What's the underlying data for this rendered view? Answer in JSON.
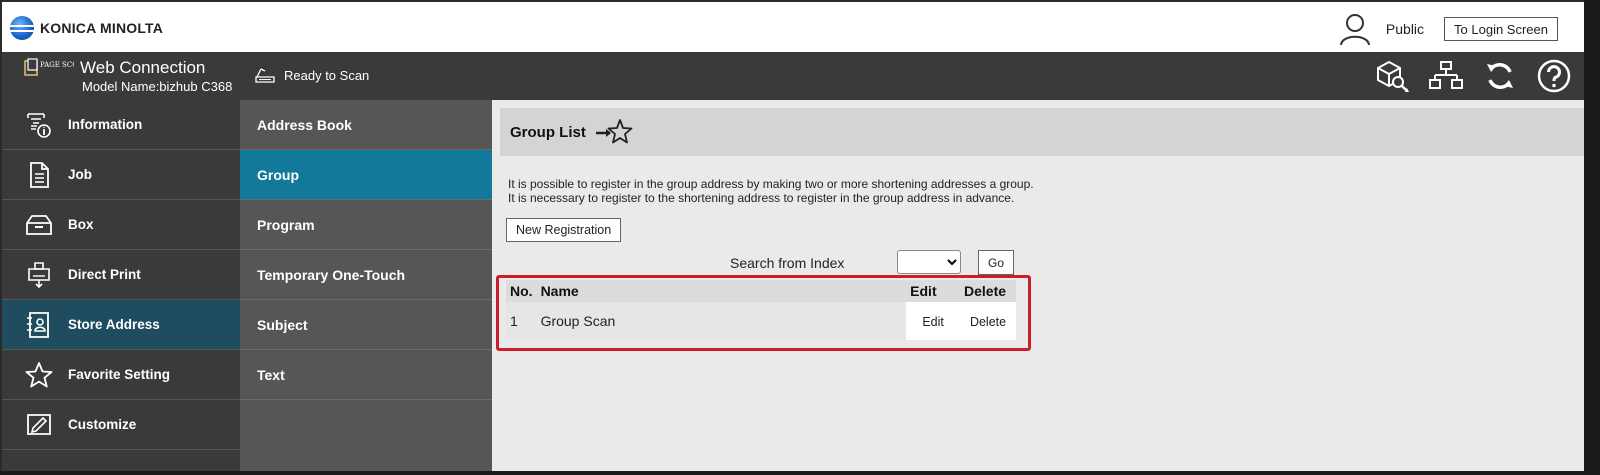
{
  "topbar": {
    "brand": "KONICA MINOLTA",
    "user_name": "Public",
    "login_button": "To Login Screen"
  },
  "header": {
    "pagescope_label": "PAGE SCOPE",
    "app_title": "Web Connection",
    "model_label": "Model Name:bizhub C368",
    "status": "Ready to Scan",
    "icons": [
      "search-box-icon",
      "network-icon",
      "refresh-icon",
      "help-icon"
    ]
  },
  "sidebar": {
    "items": [
      {
        "label": "Information",
        "icon": "information-icon",
        "active": false
      },
      {
        "label": "Job",
        "icon": "job-icon",
        "active": false
      },
      {
        "label": "Box",
        "icon": "box-icon",
        "active": false
      },
      {
        "label": "Direct Print",
        "icon": "direct-print-icon",
        "active": false
      },
      {
        "label": "Store Address",
        "icon": "store-address-icon",
        "active": true
      },
      {
        "label": "Favorite Setting",
        "icon": "star-icon",
        "active": false
      },
      {
        "label": "Customize",
        "icon": "customize-icon",
        "active": false
      }
    ]
  },
  "submenu": {
    "items": [
      {
        "label": "Address Book",
        "active": false
      },
      {
        "label": "Group",
        "active": true
      },
      {
        "label": "Program",
        "active": false
      },
      {
        "label": "Temporary One-Touch",
        "active": false
      },
      {
        "label": "Subject",
        "active": false
      },
      {
        "label": "Text",
        "active": false
      }
    ]
  },
  "main": {
    "title": "Group List",
    "desc_line1": "It is possible to register in the group address by making two or more shortening addresses a group.",
    "desc_line2": "It is necessary to register to the shortening address to register in the group address in advance.",
    "new_registration": "New Registration",
    "search_label": "Search from Index",
    "search_value": "",
    "go_button": "Go",
    "table": {
      "headers": {
        "no": "No.",
        "name": "Name",
        "edit": "Edit",
        "delete": "Delete"
      },
      "rows": [
        {
          "no": "1",
          "name": "Group Scan",
          "edit": "Edit",
          "delete": "Delete"
        }
      ]
    }
  },
  "colors": {
    "header_bg": "#3a3a3a",
    "submenu_bg": "#565656",
    "active_sub": "#12799a",
    "active_side": "#1f4d5f",
    "highlight": "#c8202c"
  }
}
